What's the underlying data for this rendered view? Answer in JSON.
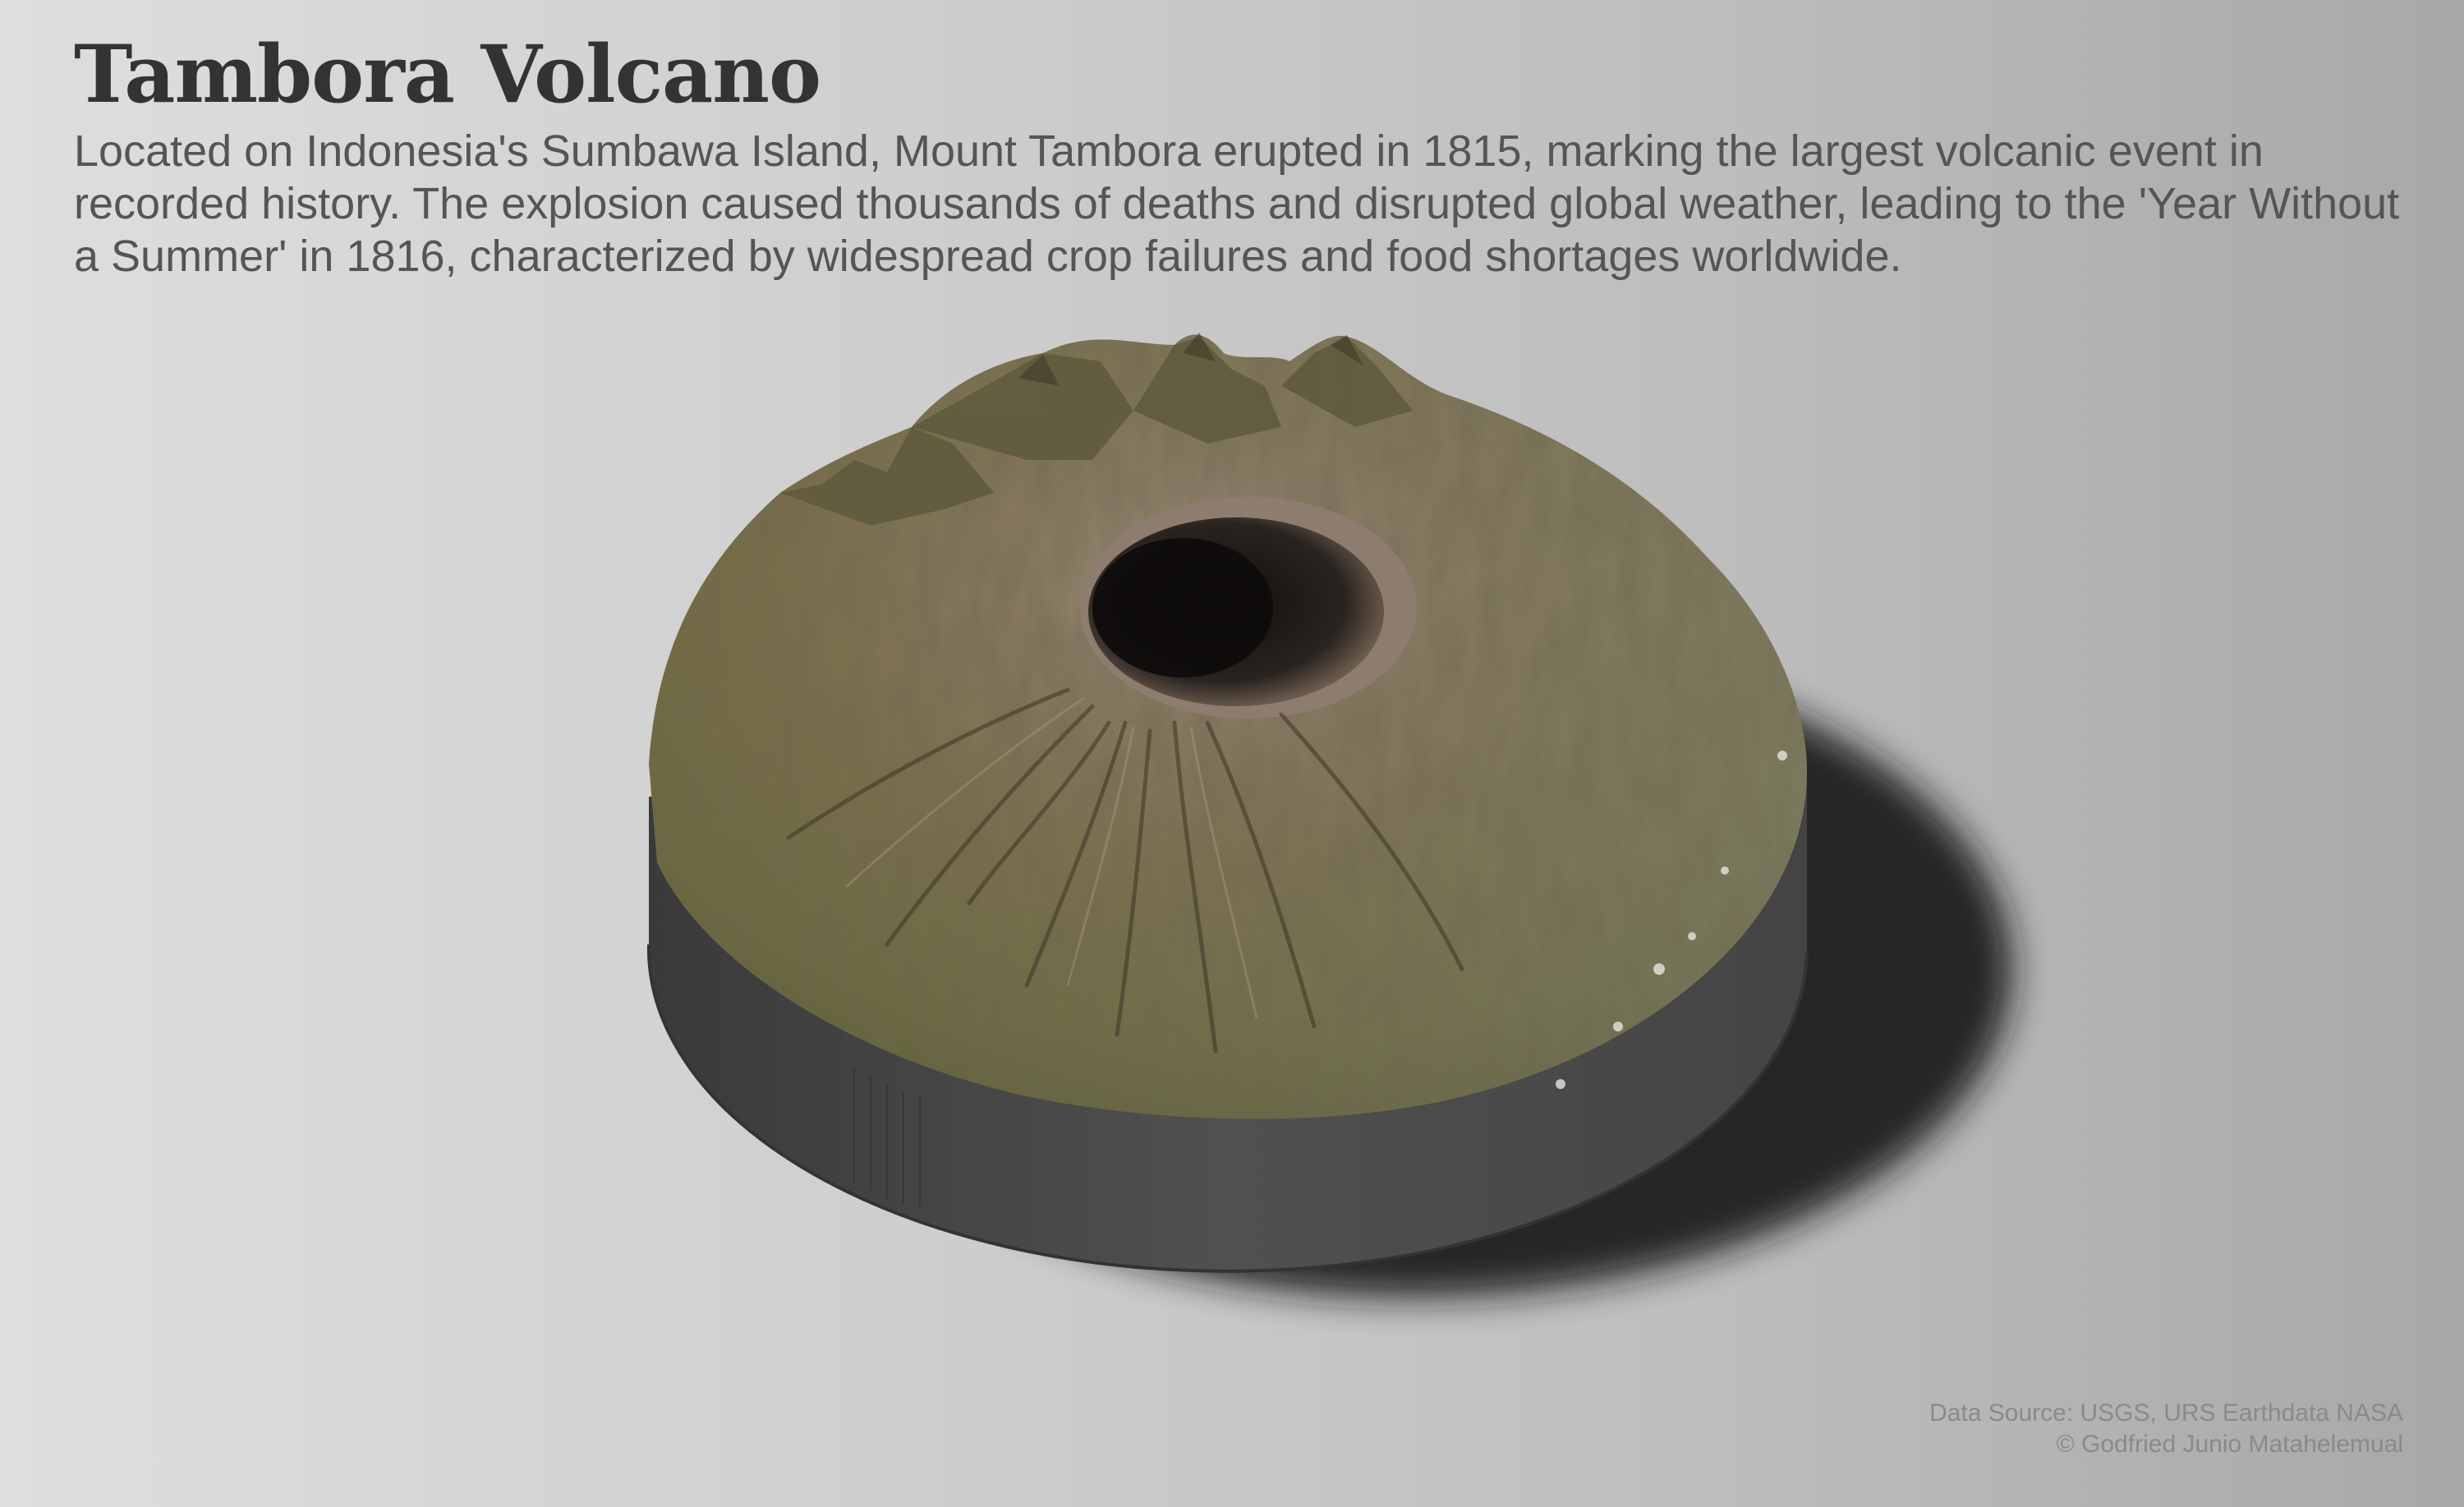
{
  "header": {
    "title": "Tambora Volcano",
    "description": "Located on Indonesia's Sumbawa Island, Mount Tambora erupted in 1815, marking the largest volcanic event in recorded history. The explosion caused thousands of deaths and disrupted global weather, leading to the 'Year Without a Summer' in 1816, characterized by widespread crop failures and food shortages worldwide."
  },
  "footer": {
    "source": "Data Source: USGS, URS Earthdata NASA",
    "copyright": "© Godfried Junio Matahelemual"
  },
  "colors": {
    "background_light": "#dedede",
    "background_dark": "#a8a8a8",
    "title": "#333333",
    "description": "#555555",
    "terrain_green": "#6b6a3e",
    "terrain_brown": "#7a6644",
    "crater": "#1a1614",
    "base": "#4b4b4b",
    "shadow": "#1a1a1a"
  }
}
